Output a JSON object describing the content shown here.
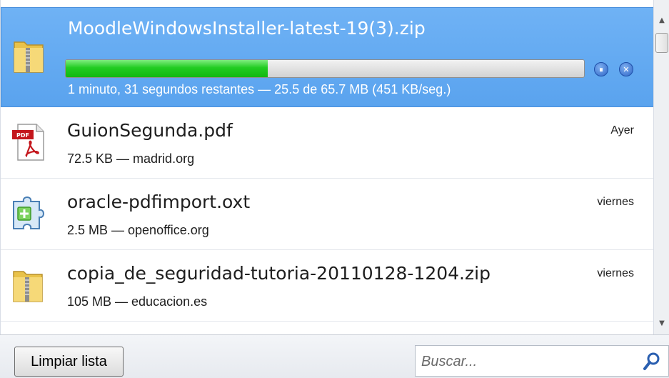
{
  "downloads": [
    {
      "name": "MoodleWindowsInstaller-latest-19(3).zip",
      "status": "1 minuto, 31 segundos restantes — 25.5 de 65.7 MB (451 KB/seg.)",
      "progress_fraction": 0.39,
      "icon": "zip-folder-icon",
      "pause_symbol": "⏸",
      "cancel_symbol": "✕"
    },
    {
      "name": "GuionSegunda.pdf",
      "meta": "72.5 KB — madrid.org",
      "date": "Ayer",
      "icon": "pdf-file-icon",
      "pdf_label": "PDF"
    },
    {
      "name": "oracle-pdfimport.oxt",
      "meta": "2.5 MB — openoffice.org",
      "date": "viernes",
      "icon": "extension-puzzle-icon"
    },
    {
      "name": "copia_de_seguridad-tutoria-20110128-1204.zip",
      "meta": "105 MB — educacion.es",
      "date": "viernes",
      "icon": "zip-folder-icon"
    }
  ],
  "bottom_bar": {
    "clear_button_label": "Limpiar lista",
    "search_placeholder": "Buscar..."
  },
  "colors": {
    "active_row": "#5aa3ee",
    "progress_fill": "#22cc22"
  }
}
